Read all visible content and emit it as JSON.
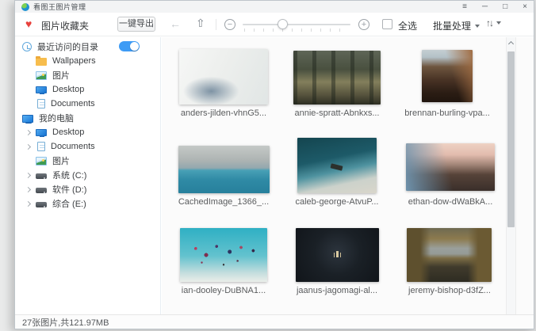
{
  "window": {
    "title": "看图王图片管理"
  },
  "titlebar": {
    "menu_icon": "≡",
    "minimize_icon": "─",
    "maximize_icon": "□",
    "close_icon": "×"
  },
  "toolbar": {
    "heart_icon": "♥",
    "favorites_label": "图片收藏夹",
    "export_button": "一键导出",
    "back_icon": "←",
    "up_icon": "⇧",
    "zoom_out_icon": "−",
    "zoom_in_icon": "+",
    "slider_position_percent": 32,
    "select_all_label": "全选",
    "select_all_checked": false,
    "batch_button": "批量处理",
    "sort_icon": "↑↓"
  },
  "sidebar": {
    "items": [
      {
        "icon": "clock",
        "label": "最近访问的目录",
        "level": 0,
        "arrow": false,
        "toggle": true,
        "toggle_on": true
      },
      {
        "icon": "folder",
        "label": "Wallpapers",
        "level": 1,
        "arrow": false,
        "toggle": false
      },
      {
        "icon": "pictures",
        "label": "图片",
        "level": 1,
        "arrow": false,
        "toggle": false
      },
      {
        "icon": "desktop",
        "label": "Desktop",
        "level": 1,
        "arrow": false,
        "toggle": false
      },
      {
        "icon": "document",
        "label": "Documents",
        "level": 1,
        "arrow": false,
        "toggle": false
      },
      {
        "icon": "computer",
        "label": "我的电脑",
        "level": 0,
        "arrow": false,
        "toggle": false
      },
      {
        "icon": "desktop",
        "label": "Desktop",
        "level": 1,
        "arrow": true,
        "toggle": false
      },
      {
        "icon": "document",
        "label": "Documents",
        "level": 1,
        "arrow": true,
        "toggle": false
      },
      {
        "icon": "pictures",
        "label": "图片",
        "level": 1,
        "arrow": false,
        "toggle": false
      },
      {
        "icon": "drive",
        "label": "系统 (C:)",
        "level": 1,
        "arrow": true,
        "toggle": false
      },
      {
        "icon": "drive",
        "label": "软件 (D:)",
        "level": 1,
        "arrow": true,
        "toggle": false
      },
      {
        "icon": "drive",
        "label": "综合 (E:)",
        "level": 1,
        "arrow": true,
        "toggle": false
      }
    ]
  },
  "gallery": {
    "items": [
      {
        "name": "anders-jilden-vhnG5...",
        "photo": "snow-aerial"
      },
      {
        "name": "annie-spratt-Abnkxs...",
        "photo": "forest-deer"
      },
      {
        "name": "brennan-burling-vpa...",
        "photo": "canyon-mountains"
      },
      {
        "name": "CachedImage_1366_...",
        "photo": "sea-horizon"
      },
      {
        "name": "caleb-george-AtvuP...",
        "photo": "boat-aerial"
      },
      {
        "name": "ethan-dow-dWaBkA...",
        "photo": "sunset-coast"
      },
      {
        "name": "ian-dooley-DuBNA1...",
        "photo": "hot-air-balloons"
      },
      {
        "name": "jaanus-jagomagi-al...",
        "photo": "dark-water-person"
      },
      {
        "name": "jeremy-bishop-d3fZ...",
        "photo": "autumn-lake"
      }
    ]
  },
  "statusbar": {
    "text": "27张图片,共121.97MB"
  },
  "colors": {
    "accent_blue": "#3d9bf5",
    "heart_red": "#e8413c",
    "folder_yellow": "#f7bd4d",
    "content_bg": "#fbfbfb"
  }
}
